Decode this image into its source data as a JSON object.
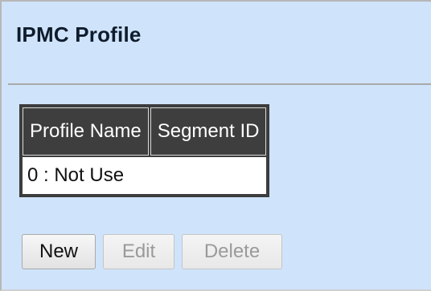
{
  "page": {
    "title": "IPMC Profile"
  },
  "table": {
    "columns": [
      "Profile Name",
      "Segment ID"
    ],
    "rows": [
      {
        "text": "0 : Not Use"
      }
    ]
  },
  "buttons": {
    "new": "New",
    "edit": "Edit",
    "delete": "Delete"
  }
}
